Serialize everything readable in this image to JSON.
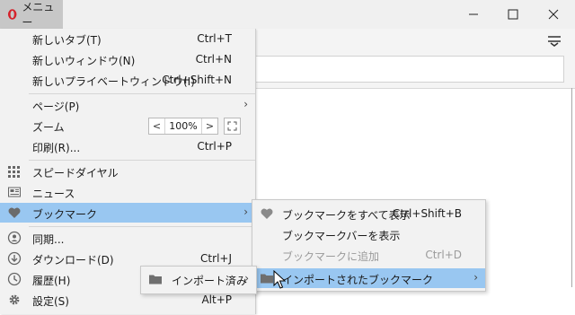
{
  "menu_button": {
    "label": "メニュー"
  },
  "main_menu": {
    "items": [
      {
        "label": "新しいタブ(T)",
        "shortcut": "Ctrl+T"
      },
      {
        "label": "新しいウィンドウ(N)",
        "shortcut": "Ctrl+N"
      },
      {
        "label": "新しいプライベートウィンドウ(I)",
        "shortcut": "Ctrl+Shift+N"
      },
      {
        "label": "ページ(P)"
      },
      {
        "label": "ズーム"
      },
      {
        "label": "印刷(R)...",
        "shortcut": "Ctrl+P"
      },
      {
        "label": "スピードダイヤル",
        "icon": "grid-icon"
      },
      {
        "label": "ニュース",
        "icon": "news-icon"
      },
      {
        "label": "ブックマーク",
        "icon": "heart-icon"
      },
      {
        "label": "同期...",
        "icon": "person-icon"
      },
      {
        "label": "ダウンロード(D)",
        "shortcut": "Ctrl+J",
        "icon": "download-icon"
      },
      {
        "label": "履歴(H)",
        "icon": "clock-icon"
      },
      {
        "label": "設定(S)",
        "shortcut": "Alt+P",
        "icon": "gear-icon"
      }
    ],
    "zoom": {
      "value": "100%",
      "minus": "<",
      "plus": ">"
    }
  },
  "bookmarks_menu": {
    "items": [
      {
        "label": "ブックマークをすべて表示",
        "shortcut": "Ctrl+Shift+B",
        "icon": "heart-icon"
      },
      {
        "label": "ブックマークバーを表示"
      },
      {
        "label": "ブックマークに追加",
        "shortcut": "Ctrl+D",
        "disabled": true
      },
      {
        "label": "インポートされたブックマーク",
        "icon": "folder-icon"
      }
    ]
  },
  "import_menu": {
    "label": "インポート済み",
    "icon": "folder-icon"
  },
  "colors": {
    "highlight": "#99c7f1",
    "menu_bg": "#f2f2f2",
    "opera_red": "#d5222b"
  }
}
